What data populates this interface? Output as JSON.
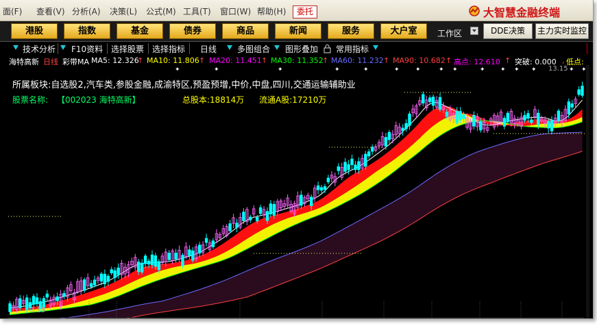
{
  "menubar": {
    "items": [
      "面(F)",
      "查看(V)",
      "分析(A)",
      "决策(L)",
      "公式(M)",
      "工具(T)",
      "窗口(W)",
      "帮助(H)"
    ],
    "weituo_label": "委托",
    "brand": "大智慧金融终端"
  },
  "navbar": {
    "buttons": [
      "港股",
      "指数",
      "基金",
      "债券",
      "商品",
      "新闻",
      "服务",
      "大户室"
    ],
    "workarea_label": "工作区",
    "dde_label": "DDE决策",
    "main_monitor_label": "主力实时监控"
  },
  "toolbar": {
    "tech_analysis": "技术分析",
    "f10": "F10资料",
    "select_stock": "选择股票",
    "select_indicator": "选择指标",
    "period": "日线",
    "multi_chart": "多图组合",
    "overlay": "图形叠加",
    "common_indicator": "常用指标"
  },
  "indicator_line": {
    "stock": "海特高新",
    "period": "日线",
    "indicator": "彩带MA",
    "ma5": "MA5: 12.326",
    "ma10": "MA10: 11.806",
    "ma20": "MA20: 11.451",
    "ma30": "MA30: 11.352",
    "ma60": "MA60: 11.232",
    "ma90": "MA90: 10.682",
    "high": "高点: 12.610",
    "breakout": "突破: 0.000",
    "low": "低点:"
  },
  "info": {
    "sectors": "所属板块:自选股2,汽车类,参股金融,成渝特区,预盈预增,中价,中盘,四川,交通运输辅助业",
    "name_label": "股票名称:",
    "name_value": "【002023 海特高新】",
    "total_shares": "总股本:18814万",
    "float_shares": "流通A股:17210万"
  },
  "price_labels": {
    "high": "13.15",
    "low": "3.19"
  },
  "colors": {
    "ma5": "#ffffff",
    "ma10": "#ffff00",
    "ma20": "#ff00ff",
    "ma30": "#00ff00",
    "ma60": "#6a6aff",
    "ma90": "#ff4040",
    "ribbon_red": "#ff1010",
    "ribbon_yellow": "#ffff00",
    "candle_up": "#ff66ff",
    "candle_down": "#00ffff",
    "brand_red": "#d01818"
  },
  "chart_data": {
    "type": "line",
    "description_series": "candlestick with colored MA ribbon",
    "price_range": [
      3.19,
      13.15
    ]
  }
}
